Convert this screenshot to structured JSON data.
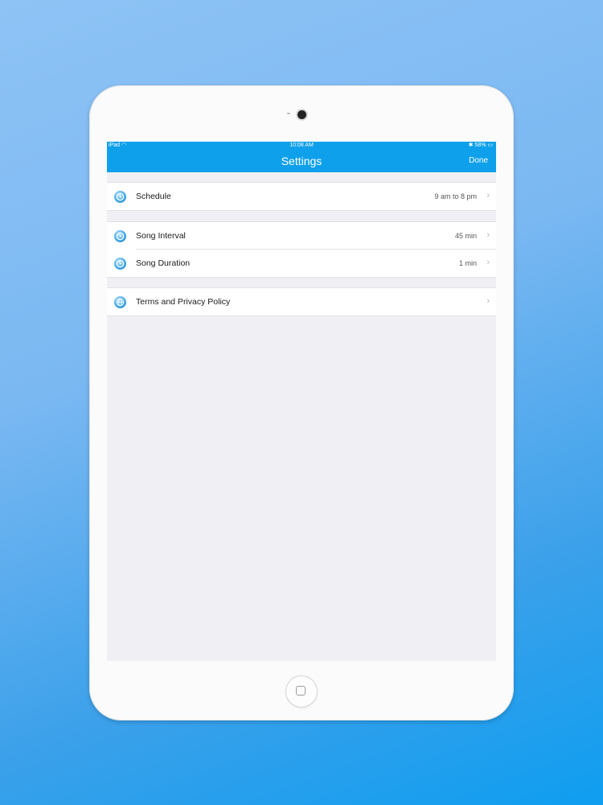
{
  "status_bar": {
    "carrier": "iPad",
    "time": "10:08 AM",
    "battery": "58%"
  },
  "nav": {
    "title": "Settings",
    "done_label": "Done"
  },
  "settings": {
    "schedule": {
      "label": "Schedule",
      "value": "9 am to 8 pm"
    },
    "song_interval": {
      "label": "Song Interval",
      "value": "45 min"
    },
    "song_duration": {
      "label": "Song Duration",
      "value": "1 min"
    },
    "terms": {
      "label": "Terms and Privacy Policy"
    }
  },
  "icons": {
    "clock": "clock-icon",
    "globe": "globe-icon",
    "chevron": "chevron-right-icon"
  },
  "colors": {
    "accent": "#0ea0ea",
    "background": "#efeff4"
  }
}
